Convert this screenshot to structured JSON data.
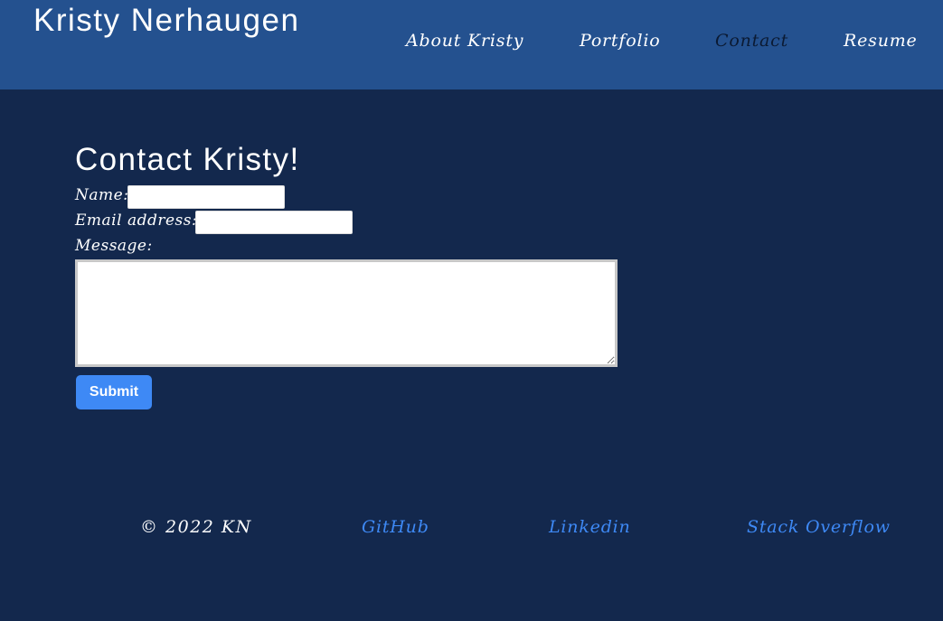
{
  "header": {
    "site_title": "Kristy Nerhaugen",
    "nav": [
      {
        "label": "About Kristy",
        "active": false
      },
      {
        "label": "Portfolio",
        "active": false
      },
      {
        "label": "Contact",
        "active": true
      },
      {
        "label": "Resume",
        "active": false
      }
    ]
  },
  "main": {
    "heading": "Contact Kristy!",
    "form": {
      "name_label": "Name:",
      "name_value": "",
      "email_label": "Email address:",
      "email_value": "",
      "message_label": "Message:",
      "message_value": "",
      "submit_label": "Submit"
    }
  },
  "footer": {
    "copyright": "© 2022 KN",
    "links": [
      {
        "label": "GitHub"
      },
      {
        "label": "Linkedin"
      },
      {
        "label": "Stack Overflow"
      }
    ]
  },
  "colors": {
    "header_bg": "#24518f",
    "page_bg": "#13284d",
    "accent": "#3e89f5",
    "active_nav": "#0b1a33"
  }
}
